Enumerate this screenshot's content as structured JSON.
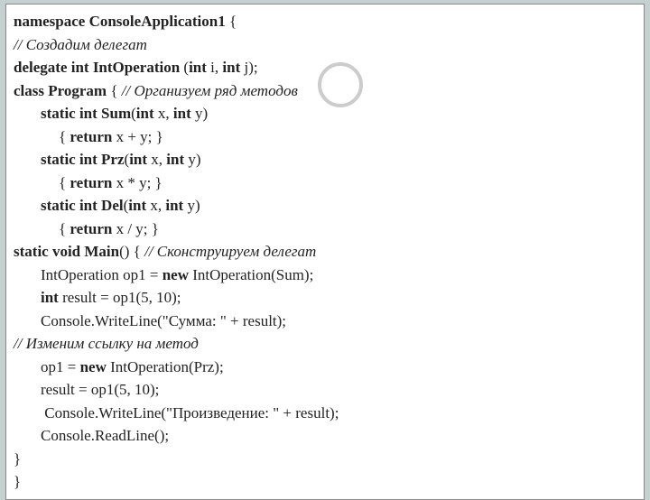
{
  "code": {
    "l1": {
      "pre": "namespace ConsoleApplication1",
      "suf": " {"
    },
    "l2": "// Создадим делегат",
    "l3a": "delegate int IntOperation",
    "l3b": " (",
    "l3c": "int",
    "l3d": " i, ",
    "l3e": "int",
    "l3f": " j);",
    "l4a": "class Program",
    "l4b": " { ",
    "l4c": "// Организуем ряд методов",
    "l5a": "static int Sum",
    "l5b": "(",
    "l5c": "int",
    "l5d": " x, ",
    "l5e": "int",
    "l5f": " y)",
    "l6a": "{ ",
    "l6b": "return",
    "l6c": " x + y; }",
    "l7a": "static int Prz",
    "l7b": "(",
    "l7c": "int",
    "l7d": " x, ",
    "l7e": "int",
    "l7f": " y)",
    "l8a": "{ ",
    "l8b": "return",
    "l8c": " x * y; }",
    "l9a": "static int Del",
    "l9b": "(",
    "l9c": "int",
    "l9d": " x, ",
    "l9e": "int",
    "l9f": " y)",
    "l10a": "{ ",
    "l10b": "return",
    "l10c": " x / y; }",
    "l11a": "static void Main",
    "l11b": "() { ",
    "l11c": "// Сконструируем делегат",
    "l12a": "IntOperation op1 = ",
    "l12b": "new",
    "l12c": " IntOperation(Sum);",
    "l13a": "int",
    "l13b": " result = op1(5, 10);",
    "l14": "Console.WriteLine(\"Сумма: \" + result);",
    "l15": "// Изменим ссылку на метод",
    "l16a": "op1 = ",
    "l16b": "new",
    "l16c": " IntOperation(Prz);",
    "l17": "result = op1(5, 10);",
    "l18": " Console.WriteLine(\"Произведение: \" + result);",
    "l19": "Console.ReadLine();",
    "l20": "}",
    "l21": "}"
  }
}
